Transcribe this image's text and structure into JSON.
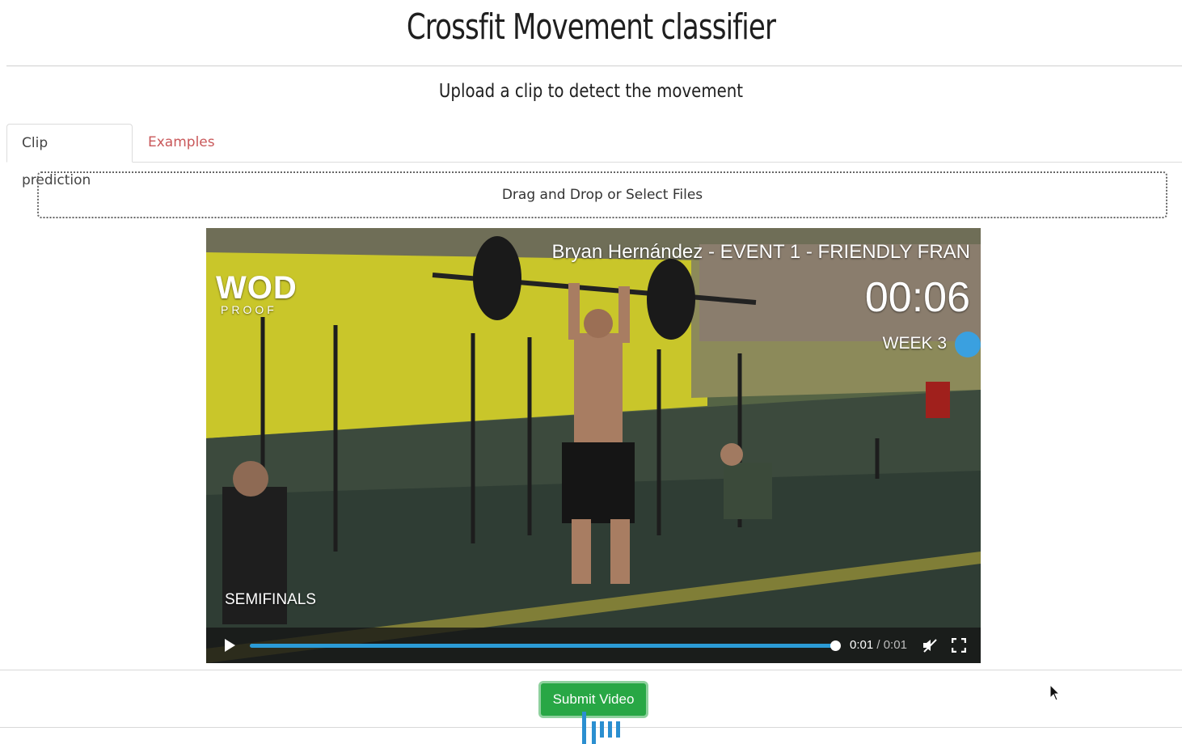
{
  "header": {
    "title": "Crossfit Movement classifier",
    "subtitle": "Upload a clip to detect the movement"
  },
  "tabs": [
    {
      "label": "Clip prediction",
      "active": true
    },
    {
      "label": "Examples",
      "active": false
    }
  ],
  "upload": {
    "label": "Drag and Drop or Select Files"
  },
  "video": {
    "overlay_event": "Bryan Hernández  - EVENT 1 - FRIENDLY FRAN",
    "overlay_timer": "00:06",
    "overlay_week": "WEEK 3",
    "overlay_stage": "SEMIFINALS",
    "overlay_logo": "WOD",
    "overlay_logo_sub": "PROOF",
    "current_time": "0:01",
    "duration": "0:01",
    "progress": 1.0
  },
  "actions": {
    "submit_label": "Submit Video"
  },
  "colors": {
    "submit_bg": "#28a745",
    "tab_link": "#c9585a",
    "progress": "#2b9bd6"
  },
  "icons": [
    "play-icon",
    "mute-icon",
    "fullscreen-icon",
    "loading-icon",
    "cursor-icon"
  ]
}
